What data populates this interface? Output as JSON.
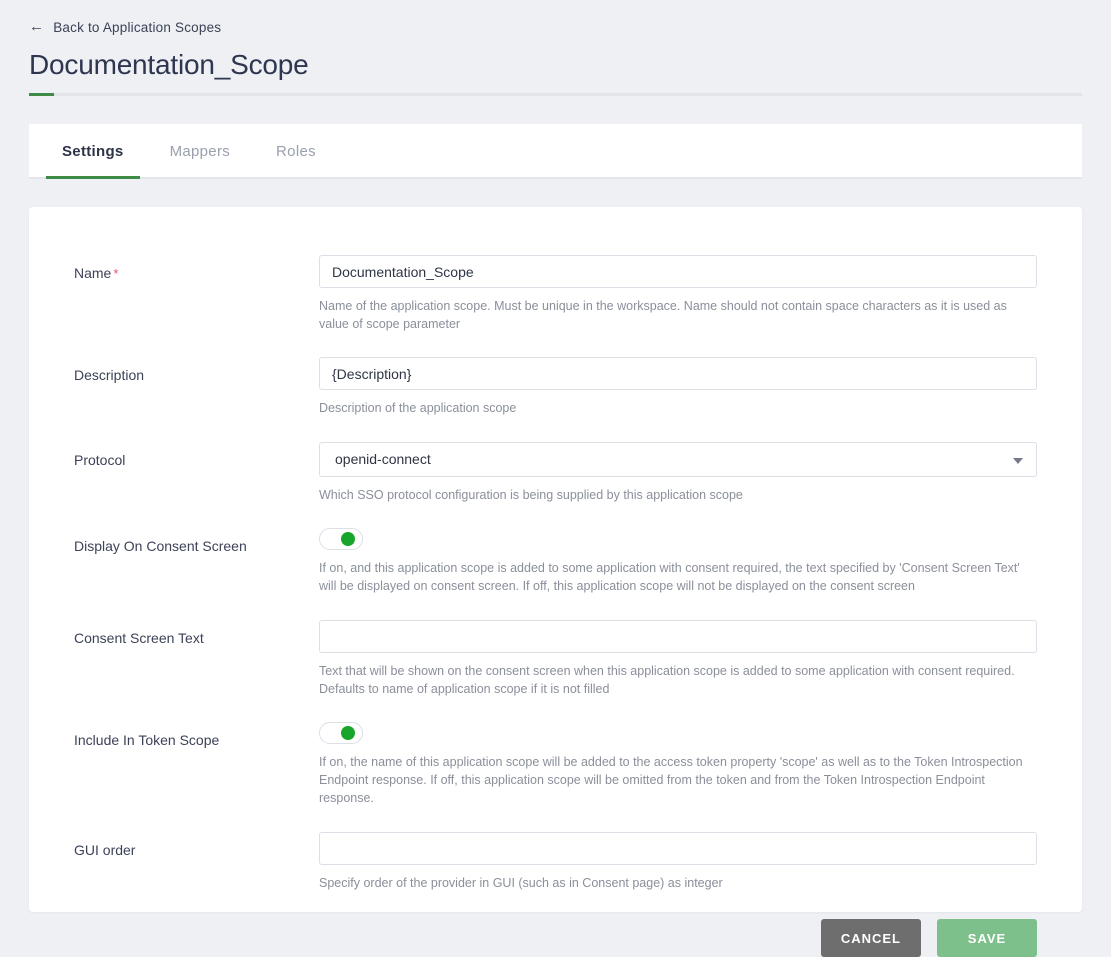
{
  "header": {
    "back_label": "Back to Application Scopes",
    "back_icon": "arrow-left-icon",
    "title": "Documentation_Scope",
    "accent_color": "#3d8b45"
  },
  "tabs": [
    {
      "label": "Settings",
      "active": true
    },
    {
      "label": "Mappers",
      "active": false
    },
    {
      "label": "Roles",
      "active": false
    }
  ],
  "form": {
    "name": {
      "label": "Name",
      "required_marker": "*",
      "value": "Documentation_Scope",
      "placeholder": "",
      "hint": "Name of the application scope. Must be unique in the workspace. Name should not contain space characters as it is used as value of scope parameter"
    },
    "description": {
      "label": "Description",
      "value": "{Description}",
      "placeholder": "",
      "hint": "Description of the application scope"
    },
    "protocol": {
      "label": "Protocol",
      "value": "openid-connect",
      "options": [
        "openid-connect"
      ],
      "caret_icon": "chevron-down-icon",
      "hint": "Which SSO protocol configuration is being supplied by this application scope"
    },
    "display_on_consent_screen": {
      "label": "Display On Consent Screen",
      "state": "on",
      "hint": "If on, and this application scope is added to some application with consent required, the text specified by 'Consent Screen Text' will be displayed on consent screen. If off, this application scope will not be displayed on the consent screen"
    },
    "consent_screen_text": {
      "label": "Consent Screen Text",
      "value": "",
      "placeholder": "",
      "hint": "Text that will be shown on the consent screen when this application scope is added to some application with consent required. Defaults to name of application scope if it is not filled"
    },
    "include_in_token_scope": {
      "label": "Include In Token Scope",
      "state": "on",
      "hint": "If on, the name of this application scope will be added to the access token property 'scope' as well as to the Token Introspection Endpoint response. If off, this application scope will be omitted from the token and from the Token Introspection Endpoint response."
    },
    "gui_order": {
      "label": "GUI order",
      "value": "",
      "placeholder": "",
      "hint": "Specify order of the provider in GUI (such as in Consent page) as integer"
    }
  },
  "actions": {
    "cancel_label": "CANCEL",
    "save_label": "SAVE",
    "cancel_color": "#6e6e6e",
    "save_color": "#7ec08c"
  }
}
